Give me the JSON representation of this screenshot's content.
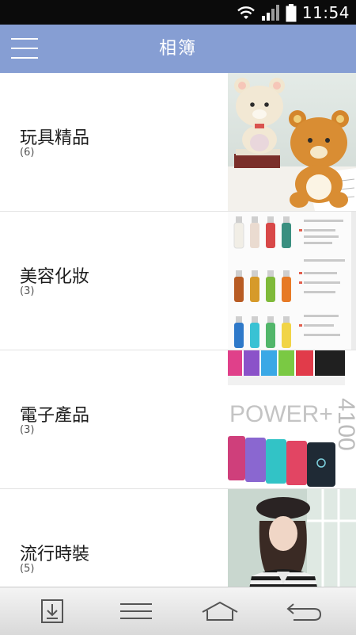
{
  "status_bar": {
    "time": "11:54",
    "icons": [
      "wifi-icon",
      "signal-icon",
      "battery-icon"
    ]
  },
  "app_bar": {
    "title": "相簿",
    "menu_icon": "hamburger-icon"
  },
  "albums": [
    {
      "name": "玩具精品",
      "count": "(6)"
    },
    {
      "name": "美容化妝",
      "count": "(3)"
    },
    {
      "name": "電子產品",
      "count": "(3)"
    },
    {
      "name": "流行時裝",
      "count": "(5)"
    }
  ],
  "thumb_text": {
    "power": "POWER+",
    "capacity": "4100"
  },
  "nav_bar": {
    "icons": [
      "download-box-icon",
      "menu-lines-icon",
      "home-icon",
      "back-icon"
    ]
  },
  "colors": {
    "app_bar": "#869ed3",
    "status_bar": "#0b0b0b",
    "nav_bar": "#e6e6e6"
  }
}
